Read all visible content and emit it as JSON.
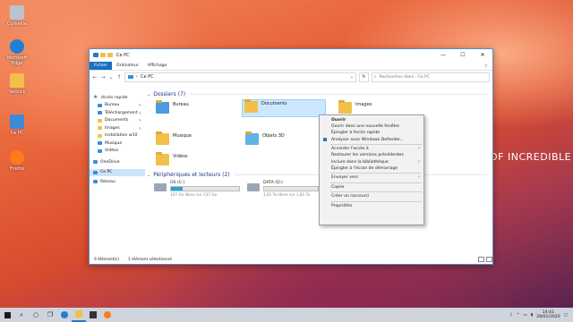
{
  "desktop": {
    "icons": [
      {
        "label": "Corbeille",
        "icon": "recycle-bin-icon"
      },
      {
        "label": "Microsoft Edge",
        "icon": "edge-icon"
      },
      {
        "label": "Yannick",
        "icon": "user-folder-icon"
      },
      {
        "label": "Ce PC",
        "icon": "computer-icon"
      },
      {
        "label": "Firefox",
        "icon": "firefox-icon"
      }
    ],
    "wallpaper_text": "OF INCREDIBLE"
  },
  "window": {
    "title": "Ce PC",
    "controls": {
      "minimize": "—",
      "maximize": "☐",
      "close": "✕"
    },
    "ribbon_tabs": [
      "Fichier",
      "Ordinateur",
      "Affichage"
    ],
    "help_icon": "?",
    "address": "Ce PC",
    "search_placeholder": "Rechercher dans : Ce PC"
  },
  "sidebar": {
    "items": [
      {
        "label": "Accès rapide",
        "icon": "star-icon",
        "indent": false
      },
      {
        "label": "Bureau",
        "icon": "folder-blue-icon",
        "indent": true,
        "pinned": true
      },
      {
        "label": "Téléchargement",
        "icon": "download-icon",
        "indent": true,
        "pinned": true
      },
      {
        "label": "Documents",
        "icon": "folder-icon",
        "indent": true,
        "pinned": true
      },
      {
        "label": "Images",
        "icon": "folder-icon",
        "indent": true,
        "pinned": true
      },
      {
        "label": "installation w10",
        "icon": "folder-icon",
        "indent": true
      },
      {
        "label": "Musique",
        "icon": "music-icon",
        "indent": true
      },
      {
        "label": "Vidéos",
        "icon": "video-icon",
        "indent": true
      },
      {
        "label": "OneDrive",
        "icon": "cloud-icon",
        "indent": false
      },
      {
        "label": "Ce PC",
        "icon": "computer-icon",
        "indent": false,
        "selected": true
      },
      {
        "label": "Réseau",
        "icon": "network-icon",
        "indent": false
      }
    ]
  },
  "content": {
    "folders_header": "Dossiers (7)",
    "folders": [
      "Bureau",
      "Documents",
      "Images",
      "Musique",
      "Objets 3D",
      "Vidéos"
    ],
    "drives_header": "Périphériques et lecteurs (2)",
    "drives": [
      {
        "name": "OS (C:)",
        "free": "197 Go libres sur 237 Go",
        "used_fraction": 0.17
      },
      {
        "name": "DATA (D:)",
        "free": "1,81 To libres sur 1,81 To",
        "used_fraction": 0.0
      }
    ]
  },
  "status": {
    "count": "9 élément(s)",
    "selected": "1 élément sélectionné"
  },
  "context_menu": {
    "items": [
      {
        "label": "Ouvrir",
        "bold": true
      },
      {
        "label": "Ouvrir dans une nouvelle fenêtre"
      },
      {
        "label": "Épingler à Accès rapide"
      },
      {
        "label": "Analyser avec Windows Defender...",
        "icon": "defender-icon"
      },
      {
        "sep": true
      },
      {
        "label": "Accorder l'accès à",
        "submenu": true
      },
      {
        "label": "Restaurer les versions précédentes"
      },
      {
        "label": "Inclure dans la bibliothèque",
        "submenu": true
      },
      {
        "label": "Épingler à l'écran de démarrage"
      },
      {
        "sep": true
      },
      {
        "label": "Envoyer vers",
        "submenu": true
      },
      {
        "sep": true
      },
      {
        "label": "Copier"
      },
      {
        "sep": true
      },
      {
        "label": "Créer un raccourci"
      },
      {
        "sep": true
      },
      {
        "label": "Propriétés"
      }
    ]
  },
  "taskbar": {
    "time": "14:41",
    "date": "28/01/2020"
  }
}
